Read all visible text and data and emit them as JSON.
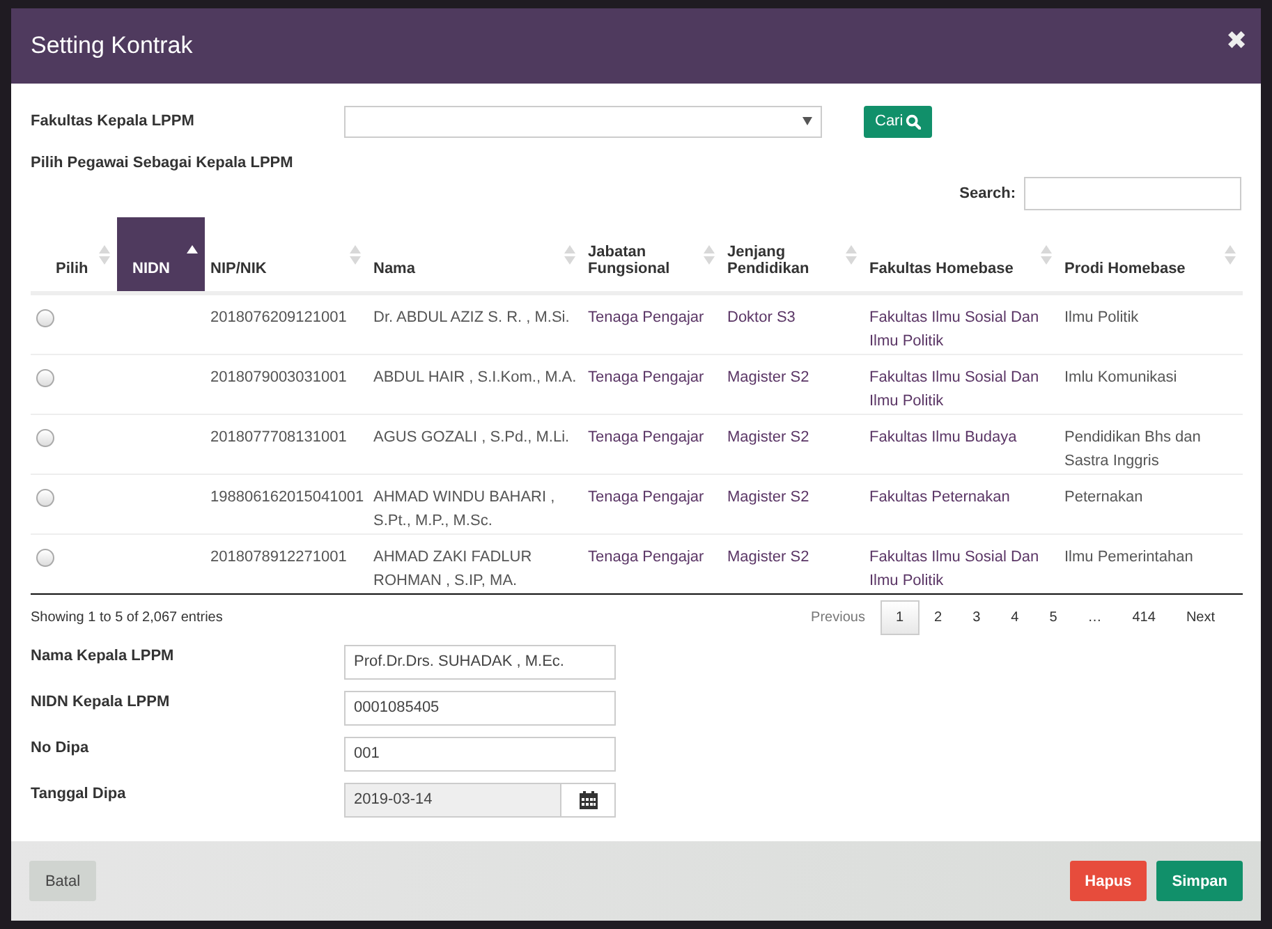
{
  "modal": {
    "title": "Setting Kontrak",
    "close": "✖"
  },
  "filter": {
    "label": "Fakultas Kepala LPPM",
    "button": "Cari"
  },
  "subtitle": "Pilih Pegawai Sebagai Kepala LPPM",
  "search": {
    "label": "Search:"
  },
  "table": {
    "columns": [
      {
        "label": "Pilih",
        "sorted": false
      },
      {
        "label": "NIDN",
        "sorted": true
      },
      {
        "label": "NIP/NIK",
        "sorted": false
      },
      {
        "label": "Nama",
        "sorted": false
      },
      {
        "label": "Jabatan Fungsional",
        "sorted": false
      },
      {
        "label": "Jenjang Pendidikan",
        "sorted": false
      },
      {
        "label": "Fakultas Homebase",
        "sorted": false
      },
      {
        "label": "Prodi Homebase",
        "sorted": false
      }
    ],
    "rows": [
      {
        "selected": false,
        "nip": "2018076209121001",
        "nama": "Dr. ABDUL AZIZ S. R. , M.Si.",
        "jabatan": "Tenaga Pengajar",
        "jenjang": "Doktor S3",
        "fakultas": "Fakultas Ilmu Sosial Dan Ilmu Politik",
        "prodi": "Ilmu Politik"
      },
      {
        "selected": false,
        "nip": "2018079003031001",
        "nama": "ABDUL HAIR , S.I.Kom., M.A.",
        "jabatan": "Tenaga Pengajar",
        "jenjang": "Magister S2",
        "fakultas": "Fakultas Ilmu Sosial Dan Ilmu Politik",
        "prodi": "Imlu Komunikasi"
      },
      {
        "selected": false,
        "nip": "2018077708131001",
        "nama": "AGUS GOZALI , S.Pd., M.Li.",
        "jabatan": "Tenaga Pengajar",
        "jenjang": "Magister S2",
        "fakultas": "Fakultas Ilmu Budaya",
        "prodi": "Pendidikan Bhs dan Sastra Inggris"
      },
      {
        "selected": false,
        "nip": "198806162015041001",
        "nama": "AHMAD WINDU BAHARI , S.Pt., M.P., M.Sc.",
        "jabatan": "Tenaga Pengajar",
        "jenjang": "Magister S2",
        "fakultas": "Fakultas Peternakan",
        "prodi": "Peternakan"
      },
      {
        "selected": false,
        "nip": "2018078912271001",
        "nama": "AHMAD ZAKI FADLUR ROHMAN , S.IP, MA.",
        "jabatan": "Tenaga Pengajar",
        "jenjang": "Magister S2",
        "fakultas": "Fakultas Ilmu Sosial Dan Ilmu Politik",
        "prodi": "Ilmu Pemerintahan"
      }
    ]
  },
  "info": "Showing 1 to 5 of 2,067 entries",
  "pagination": {
    "previous": "Previous",
    "pages": [
      {
        "label": "1",
        "selected": true
      },
      {
        "label": "2",
        "selected": false
      },
      {
        "label": "3",
        "selected": false
      },
      {
        "label": "4",
        "selected": false
      },
      {
        "label": "5",
        "selected": false
      },
      {
        "label": "…",
        "selected": false
      },
      {
        "label": "414",
        "selected": false
      }
    ],
    "next": "Next"
  },
  "form": [
    {
      "label": "Nama Kepala LPPM",
      "value": "Prof.Dr.Drs. SUHADAK , M.Ec.",
      "kind": "text"
    },
    {
      "label": "NIDN Kepala LPPM",
      "value": "0001085405",
      "kind": "text"
    },
    {
      "label": "No Dipa",
      "value": "001",
      "kind": "text"
    },
    {
      "label": "Tanggal Dipa",
      "value": "2019-03-14",
      "kind": "date"
    }
  ],
  "footer": {
    "cancel": "Batal",
    "delete": "Hapus",
    "save": "Simpan"
  }
}
